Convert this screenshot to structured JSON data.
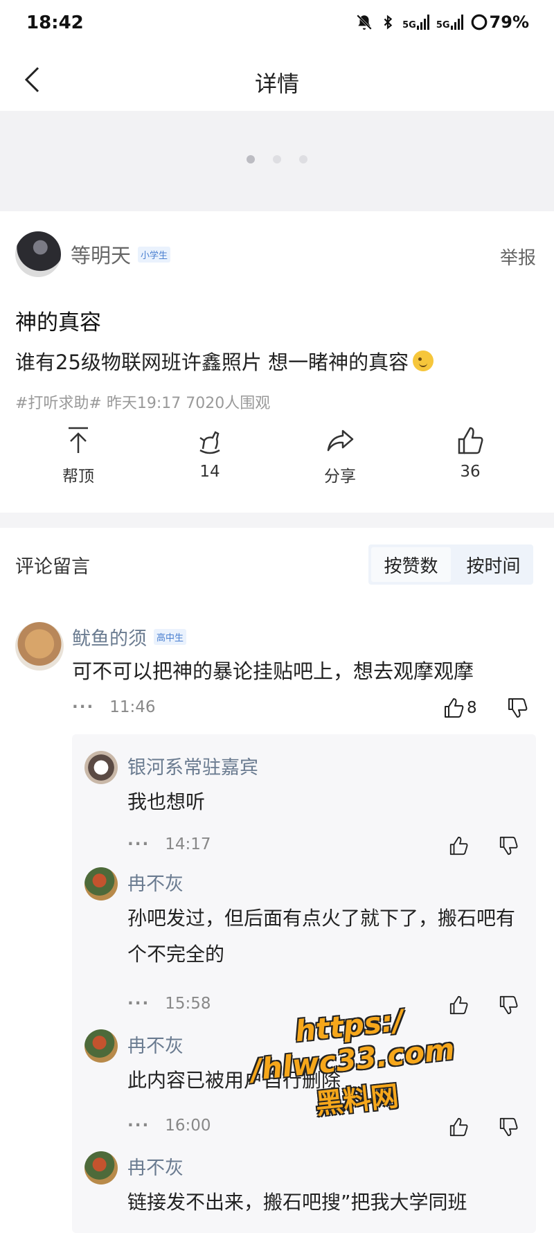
{
  "status_bar": {
    "time": "18:42",
    "network_1": "5G",
    "network_2": "5G",
    "battery": "79%",
    "icons": [
      "bell-off-icon",
      "bluetooth-icon",
      "signal-icon",
      "signal-icon",
      "battery-ring-icon"
    ]
  },
  "nav": {
    "title": "详情",
    "back_icon": "chevron-left-icon"
  },
  "carousel": {
    "count": 3,
    "active_index": 0
  },
  "post": {
    "author": "等明天",
    "author_level": "小学生",
    "report_label": "举报",
    "title": "神的真容",
    "body": "谁有25级物联网班许鑫照片 想一睹神的真容",
    "emoji": "wink-emoji",
    "meta": "#打听求助# 昨天19:17 7020人围观"
  },
  "actions": [
    {
      "icon": "pin-top-icon",
      "label": "帮顶"
    },
    {
      "icon": "rocking-horse-icon",
      "label": "14"
    },
    {
      "icon": "share-icon",
      "label": "分享"
    },
    {
      "icon": "thumbs-up-icon",
      "label": "36"
    }
  ],
  "comments_section": {
    "title": "评论留言",
    "sort_options": [
      "按赞数",
      "按时间"
    ],
    "active_sort": "按赞数"
  },
  "comments": [
    {
      "author": "鱿鱼的须",
      "level": "高中生",
      "text": "可不可以把神的暴论挂贴吧上，想去观摩观摩",
      "time": "11:46",
      "likes": "8",
      "more": "···"
    }
  ],
  "replies": [
    {
      "author": "银河系常驻嘉宾",
      "text": "我也想听",
      "time": "14:17",
      "deleted": false,
      "more": "···"
    },
    {
      "author": "冉不灰",
      "text": "孙吧发过，但后面有点火了就下了，搬石吧有个不完全的",
      "time": "15:58",
      "deleted": false,
      "more": "···"
    },
    {
      "author": "冉不灰",
      "text": "此内容已被用户自行删除",
      "time": "16:00",
      "deleted": true,
      "more": "···"
    },
    {
      "author": "冉不灰",
      "text": "链接发不出来，搬石吧搜”把我大学同班",
      "time": "",
      "deleted": false,
      "more": ""
    }
  ],
  "watermark": {
    "url": "https:/ /hlwc33.com",
    "name": "黑料网"
  },
  "colors": {
    "accent_blue": "#4a7fd0",
    "name_gray_blue": "#6a7b90",
    "watermark_orange": "#f6a71b"
  }
}
